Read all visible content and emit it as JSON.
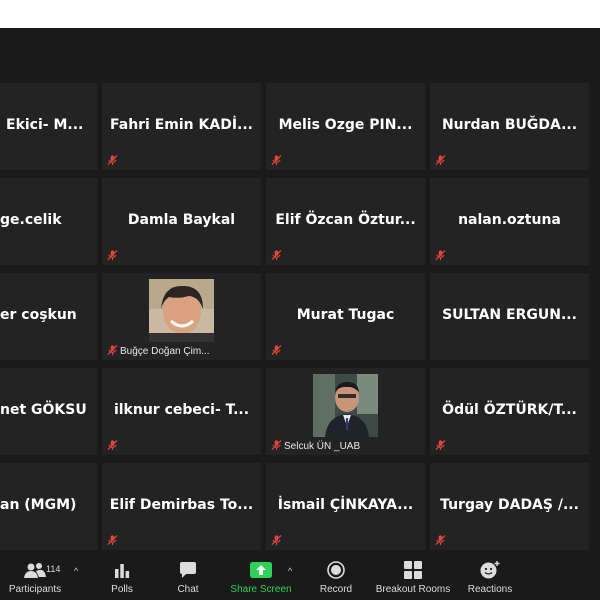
{
  "tiles": [
    {
      "name": "Ekici- M...",
      "cut": true
    },
    {
      "name": "Fahri Emin KADİ..."
    },
    {
      "name": "Melis Ozge PIN..."
    },
    {
      "name": "Nurdan BUĞDA..."
    },
    {
      "name": "ge.celik",
      "cut": true
    },
    {
      "name": "Damla Baykal"
    },
    {
      "name": "Elif Özcan Öztur..."
    },
    {
      "name": "nalan.oztuna"
    },
    {
      "name": "er coşkun",
      "cut": true
    },
    {
      "name": "Buğçe Doğan Çim...",
      "video": true
    },
    {
      "name": "Murat Tugac"
    },
    {
      "name": "SULTAN ERGUN..."
    },
    {
      "name": "net GÖKSU",
      "cut": true
    },
    {
      "name": "ilknur cebeci- T..."
    },
    {
      "name": "Selcuk ÜN _UAB",
      "video": true
    },
    {
      "name": "Ödül ÖZTÜRK/T..."
    },
    {
      "name": "an (MGM)",
      "cut": true
    },
    {
      "name": "Elif Demirbas To..."
    },
    {
      "name": "İsmail ÇİNKAYA..."
    },
    {
      "name": "Turgay DADAŞ /..."
    }
  ],
  "toolbar": {
    "participants_label": "Participants",
    "participants_count": "114",
    "polls_label": "Polls",
    "chat_label": "Chat",
    "share_label": "Share Screen",
    "record_label": "Record",
    "breakout_label": "Breakout Rooms",
    "reactions_label": "Reactions"
  },
  "colors": {
    "background": "#1a1a1a",
    "tile": "#232323",
    "muted_mic": "#e0443e",
    "share_green": "#2fd158"
  }
}
